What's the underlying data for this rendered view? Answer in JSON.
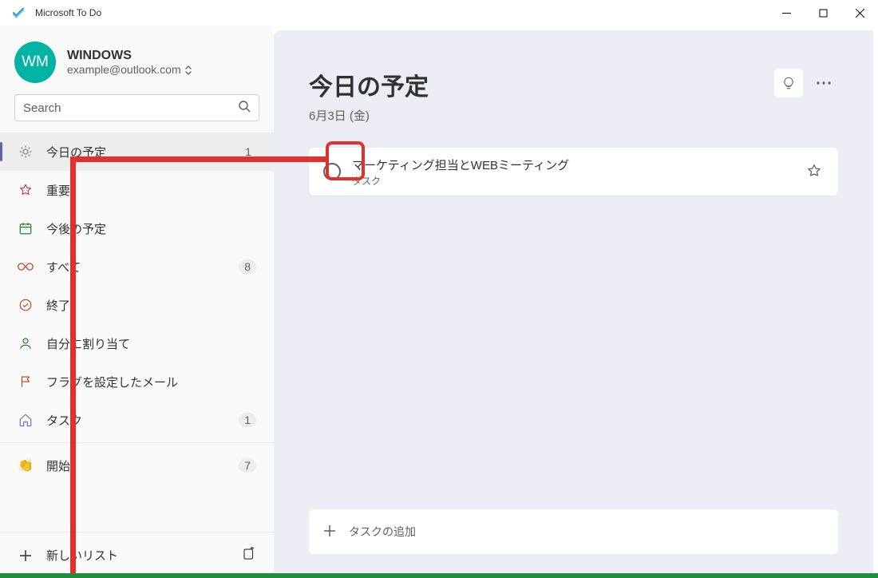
{
  "app": {
    "title": "Microsoft To Do"
  },
  "account": {
    "initials": "WM",
    "name": "WINDOWS",
    "email": "example@outlook.com"
  },
  "search": {
    "placeholder": "Search"
  },
  "sidebar": {
    "items": [
      {
        "icon": "sun",
        "label": "今日の予定",
        "badge": "1",
        "selected": true
      },
      {
        "icon": "star",
        "label": "重要",
        "badge": "",
        "selected": false
      },
      {
        "icon": "calendar",
        "label": "今後の予定",
        "badge": "",
        "selected": false
      },
      {
        "icon": "infinity",
        "label": "すべて",
        "badge": "8",
        "badgeCircle": true,
        "selected": false
      },
      {
        "icon": "check",
        "label": "終了",
        "badge": "",
        "selected": false
      },
      {
        "icon": "person",
        "label": "自分に割り当て",
        "badge": "",
        "selected": false
      },
      {
        "icon": "flag",
        "label": "フラグを設定したメール",
        "badge": "",
        "selected": false
      },
      {
        "icon": "home",
        "label": "タスク",
        "badge": "1",
        "badgeCircle": true,
        "selected": false
      }
    ],
    "lists": [
      {
        "emoji": "👏",
        "label": "開始",
        "badge": "7"
      }
    ],
    "newList": "新しいリスト"
  },
  "main": {
    "title": "今日の予定",
    "date": "6月3日 (金)",
    "addTask": "タスクの追加",
    "tasks": [
      {
        "title": "マーケティング担当とWEBミーティング",
        "sub": "タスク"
      }
    ]
  }
}
